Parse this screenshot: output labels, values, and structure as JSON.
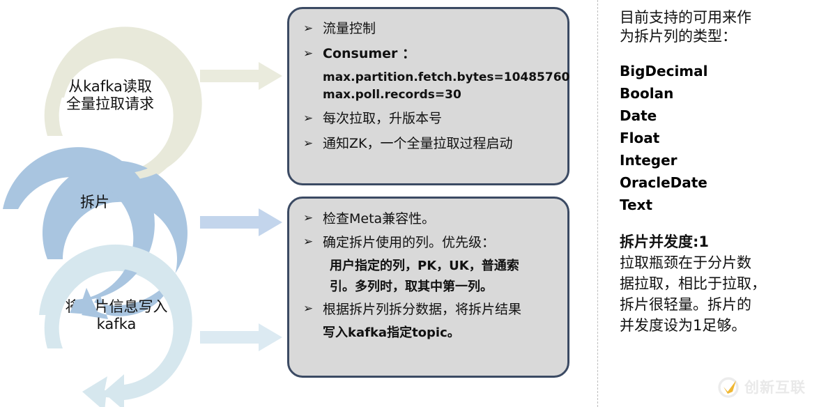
{
  "flow": {
    "steps": [
      {
        "label": "从kafka读取\n全量拉取请求",
        "arrow_color": "#e8e9da",
        "connector_color": "#eaebdd"
      },
      {
        "label": "拆片",
        "arrow_color": "#a9c5e0",
        "connector_color": "#c3d5ec"
      },
      {
        "label": "将分片信息写入\nkafka",
        "arrow_color": "#d6e7ee",
        "connector_color": "#dceaf2"
      }
    ]
  },
  "detail_boxes": [
    {
      "name": "read-request-details",
      "fill": "#d9d9d9",
      "border": "#3b4a63",
      "items": [
        {
          "bullet": "➢",
          "text": "流量控制",
          "cjk": true,
          "sublines": []
        },
        {
          "bullet": "➢",
          "text": "Consumer ：",
          "cjk": false,
          "sublines": [
            "max.partition.fetch.bytes=10485760",
            "max.poll.records=30"
          ]
        },
        {
          "bullet": "➢",
          "text": "每次拉取，升版本号",
          "cjk": true,
          "sublines": []
        },
        {
          "bullet": "➢",
          "text": "通知ZK，一个全量拉取过程启动",
          "cjk": true,
          "sublines": []
        }
      ]
    },
    {
      "name": "sharding-details",
      "fill": "#d9d9d9",
      "border": "#3b4a63",
      "items": [
        {
          "bullet": "➢",
          "text": "检查Meta兼容性。",
          "cjk": true,
          "sublines": []
        },
        {
          "bullet": "➢",
          "text": "确定拆片使用的列。优先级：",
          "cjk": true,
          "sublines": [
            "用户指定的列，PK，UK，普通索",
            "引。多列时，取其中第一列。"
          ]
        },
        {
          "bullet": "➢",
          "text": "根据拆片列拆分数据，将拆片结果",
          "cjk": true,
          "sublines": [
            "写入kafka指定topic。"
          ]
        }
      ]
    }
  ],
  "right_panel": {
    "heading": "目前支持的可用来作\n为拆片列的类型：",
    "types": [
      "BigDecimal",
      "Boolan",
      "Date",
      "Float",
      "Integer",
      "OracleDate",
      "Text"
    ],
    "note_title": "拆片并发度:1",
    "note_body": "拉取瓶颈在于分片数\n据拉取，相比于拉取，\n拆片很轻量。拆片的\n并发度设为1足够。"
  },
  "watermark": {
    "text": "创新互联",
    "mark_color": "#f0b429",
    "ring_color": "#ebebeb"
  },
  "divider": {
    "color": "#bdbdbd"
  }
}
